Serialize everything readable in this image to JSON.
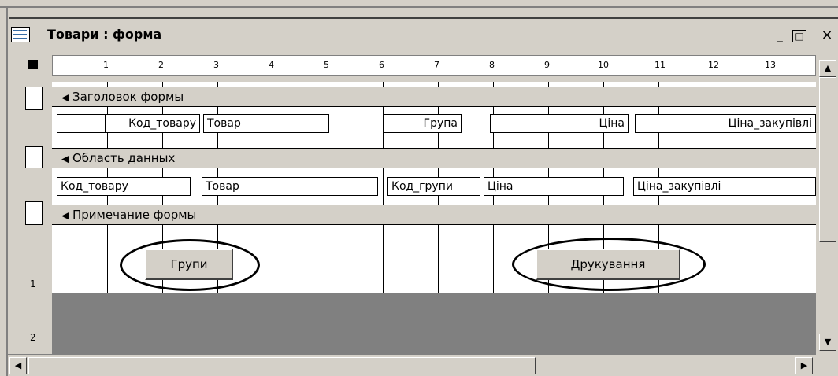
{
  "window": {
    "title": "Товари : форма",
    "controls": {
      "minimize": "_",
      "maximize": "□",
      "close": "×"
    }
  },
  "ruler": {
    "marks": [
      "1",
      "2",
      "3",
      "4",
      "5",
      "6",
      "7",
      "8",
      "9",
      "10",
      "11",
      "12",
      "13"
    ]
  },
  "vertical_ruler": {
    "marks": [
      "1",
      "2"
    ]
  },
  "sections": {
    "header": {
      "label": "Заголовок формы"
    },
    "detail": {
      "label": "Область данных"
    },
    "footer": {
      "label": "Примечание формы"
    }
  },
  "header_labels": [
    "Код_товару",
    "Товар",
    "Група",
    "Ціна",
    "Ціна_закупівлі"
  ],
  "detail_fields": [
    "Код_товару",
    "Товар",
    "Код_групи",
    "Ціна",
    "Ціна_закупівлі"
  ],
  "buttons": {
    "groups": "Групи",
    "print": "Друкування"
  },
  "icons": {
    "section_arrow": "◀",
    "scroll_up": "▲",
    "scroll_down": "▼",
    "scroll_left": "◀",
    "scroll_right": "▶"
  },
  "colors": {
    "face": "#d4d0c8",
    "canvas": "#ffffff",
    "gray_area": "#808080"
  }
}
